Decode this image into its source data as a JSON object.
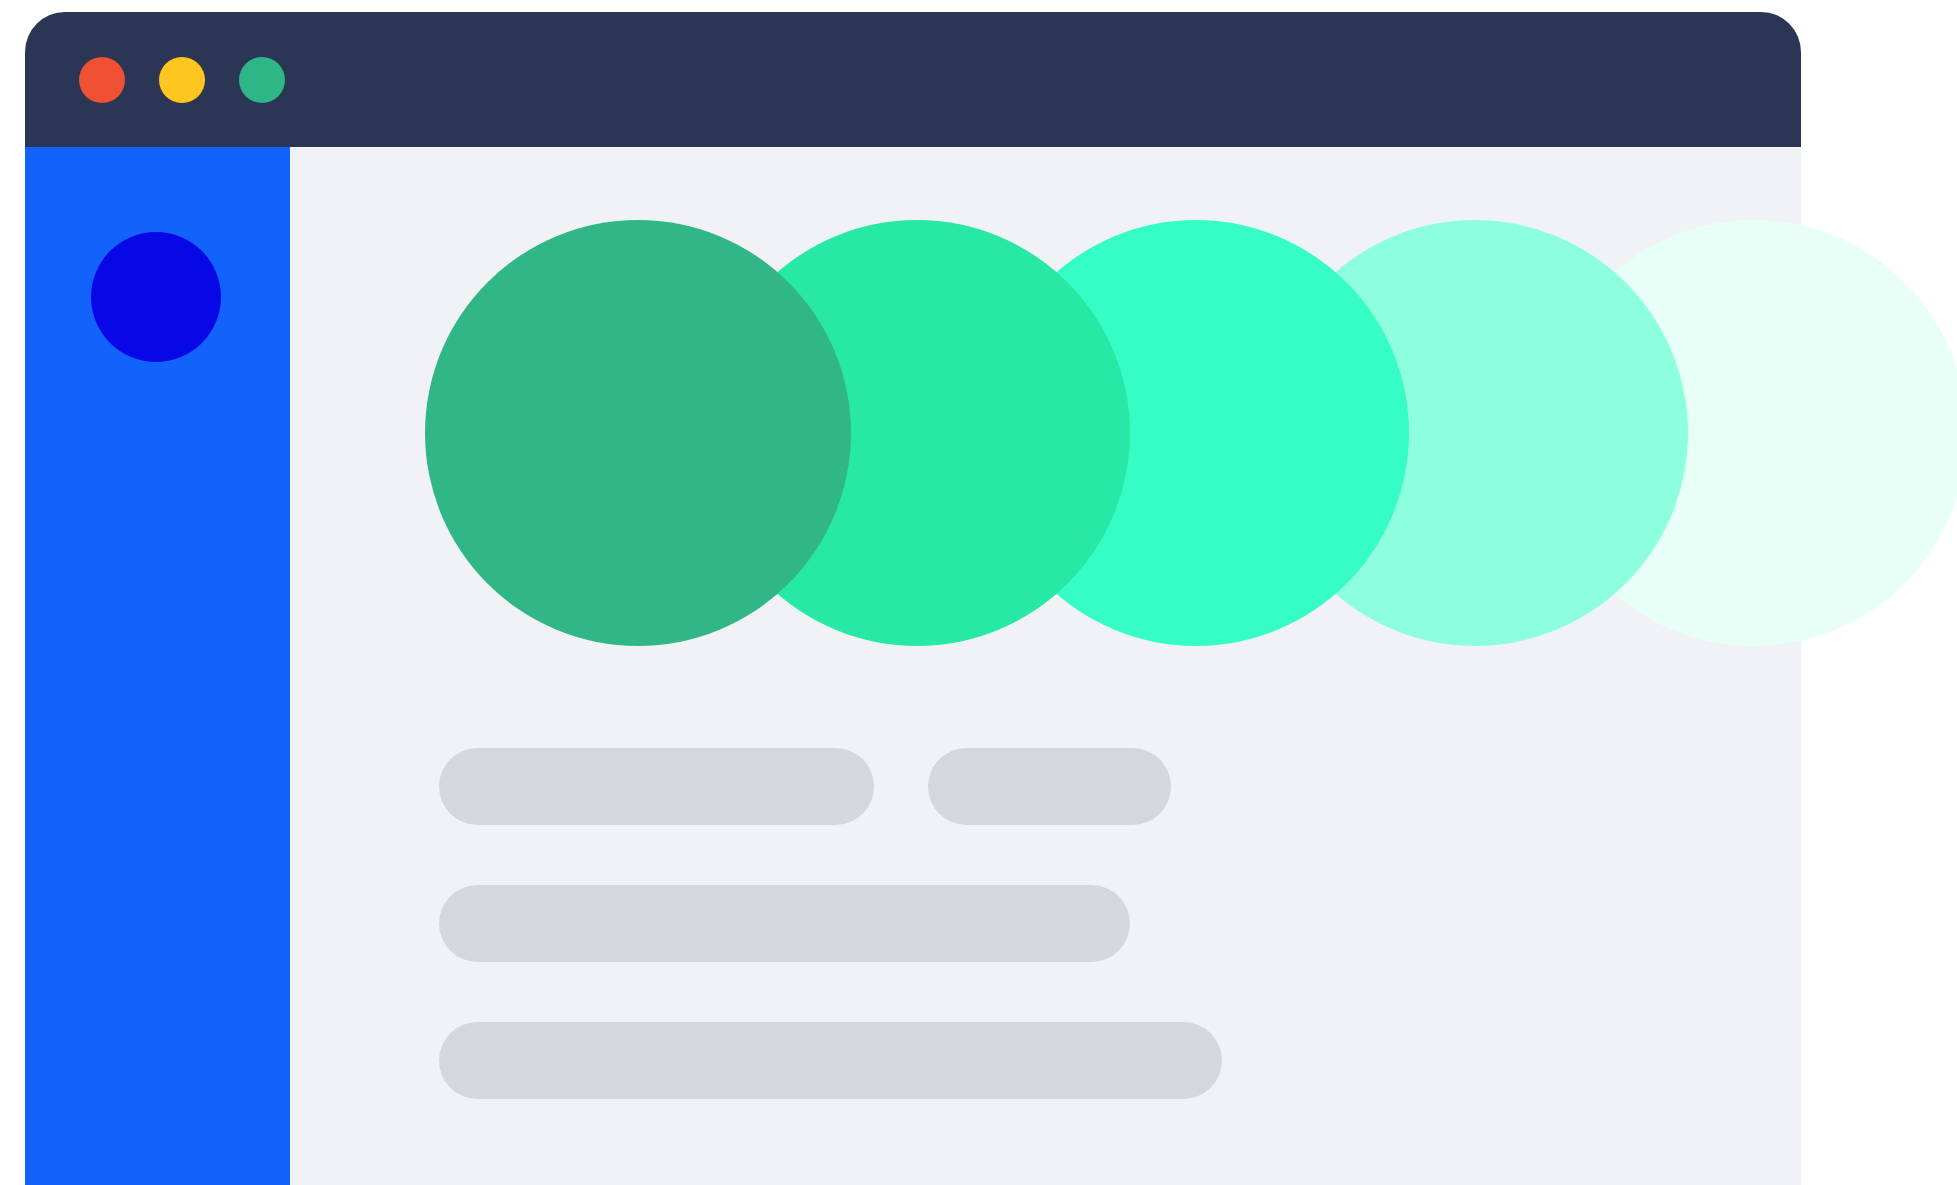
{
  "window": {
    "controls": [
      {
        "color": "#f05133"
      },
      {
        "color": "#ffc61f"
      },
      {
        "color": "#2fb686"
      }
    ]
  },
  "sidebar": {
    "avatar": {
      "color": "#0808e6"
    }
  },
  "swatches": [
    {
      "color": "#31b787"
    },
    {
      "color": "#28e8a6"
    },
    {
      "color": "#36fdc6"
    },
    {
      "color": "#8effdd"
    },
    {
      "color": "#e8fff8"
    }
  ]
}
